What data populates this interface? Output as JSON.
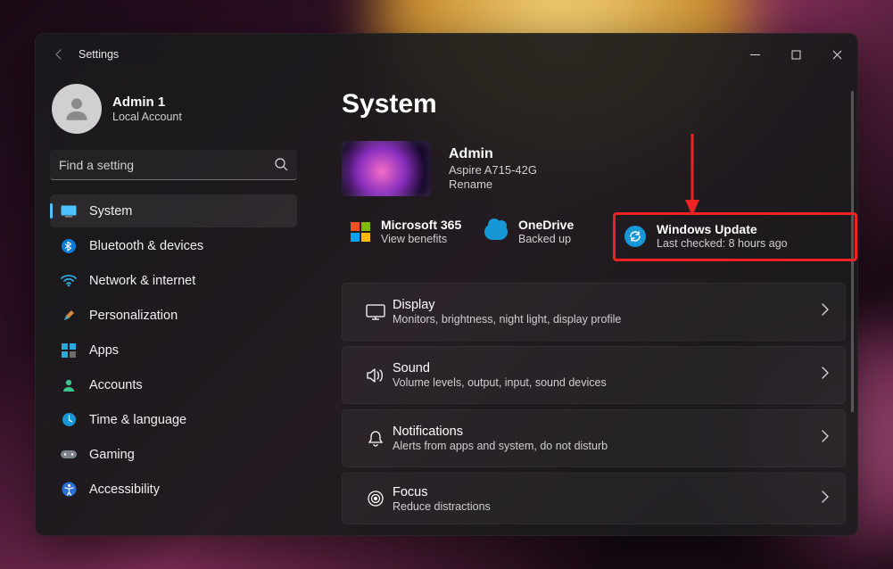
{
  "app_title": "Settings",
  "user": {
    "name": "Admin 1",
    "account_type": "Local Account"
  },
  "search": {
    "placeholder": "Find a setting"
  },
  "sidebar": {
    "items": [
      {
        "label": "System"
      },
      {
        "label": "Bluetooth & devices"
      },
      {
        "label": "Network & internet"
      },
      {
        "label": "Personalization"
      },
      {
        "label": "Apps"
      },
      {
        "label": "Accounts"
      },
      {
        "label": "Time & language"
      },
      {
        "label": "Gaming"
      },
      {
        "label": "Accessibility"
      }
    ]
  },
  "page": {
    "title": "System"
  },
  "device": {
    "name": "Admin",
    "model": "Aspire A715-42G",
    "rename": "Rename"
  },
  "tiles": {
    "m365": {
      "title": "Microsoft 365",
      "sub": "View benefits"
    },
    "onedrive": {
      "title": "OneDrive",
      "sub": "Backed up"
    },
    "winupdate": {
      "title": "Windows Update",
      "sub": "Last checked: 8 hours ago"
    }
  },
  "settings": [
    {
      "title": "Display",
      "sub": "Monitors, brightness, night light, display profile"
    },
    {
      "title": "Sound",
      "sub": "Volume levels, output, input, sound devices"
    },
    {
      "title": "Notifications",
      "sub": "Alerts from apps and system, do not disturb"
    },
    {
      "title": "Focus",
      "sub": "Reduce distractions"
    }
  ]
}
